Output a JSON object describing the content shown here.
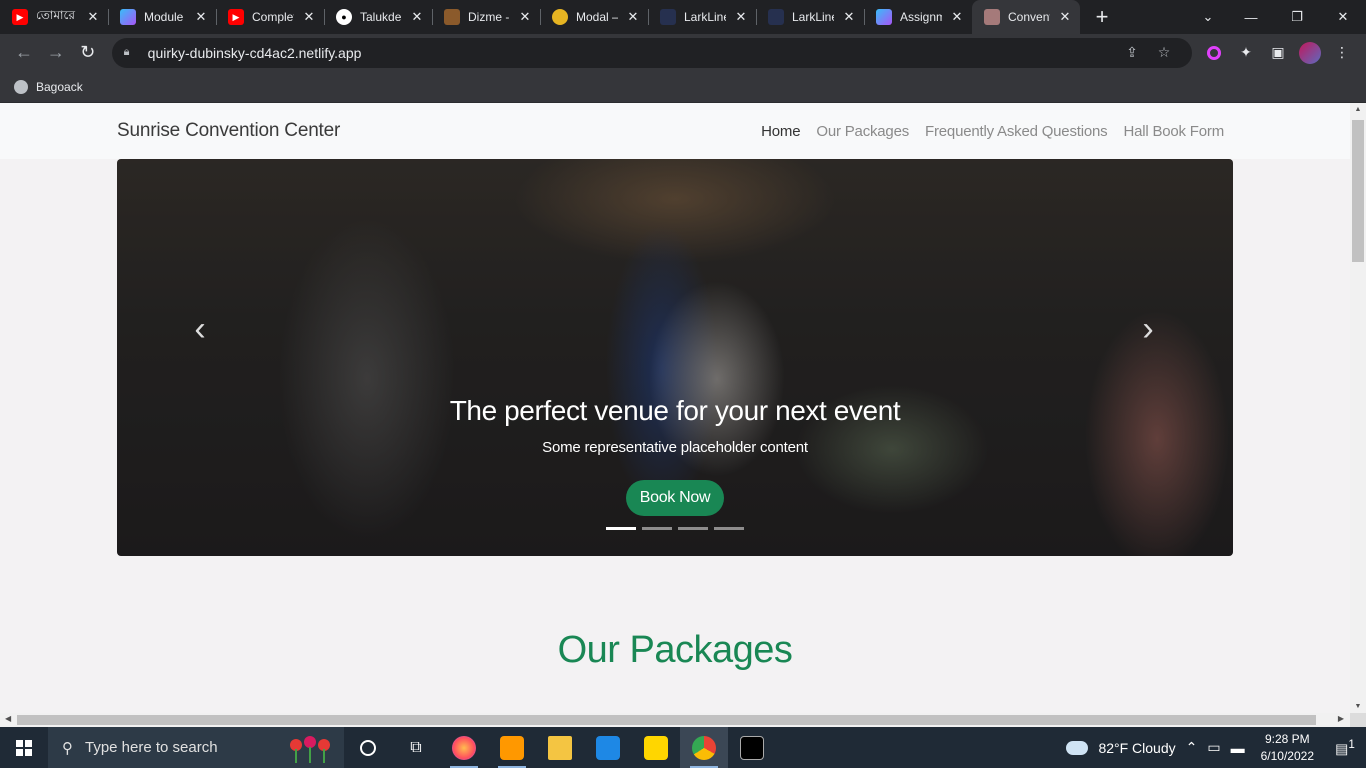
{
  "browser": {
    "tabs": [
      {
        "title": "তোমারে",
        "favicon": "youtube-icon",
        "color": "#ff0000"
      },
      {
        "title": "Module",
        "favicon": "module-icon",
        "color": "#7b61ff"
      },
      {
        "title": "Complet",
        "favicon": "youtube-icon",
        "color": "#ff0000"
      },
      {
        "title": "Talukder",
        "favicon": "github-icon",
        "color": "#ffffff"
      },
      {
        "title": "Dizme -",
        "favicon": "dizme-icon",
        "color": "#8b5a2b"
      },
      {
        "title": "Modal –",
        "favicon": "flower-icon",
        "color": "#e6b422"
      },
      {
        "title": "LarkLine",
        "favicon": "larkline-icon",
        "color": "#3c4a7a"
      },
      {
        "title": "LarkLine",
        "favicon": "larkline-icon",
        "color": "#3c4a7a"
      },
      {
        "title": "Assignm",
        "favicon": "module-icon",
        "color": "#7b61ff"
      },
      {
        "title": "Convent",
        "favicon": "image-icon",
        "color": "#a57a7a",
        "active": true
      }
    ],
    "new_tab": "+",
    "address": "quirky-dubinsky-cd4ac2.netlify.app",
    "bookmark": "Bagoack"
  },
  "page": {
    "brand": "Sunrise Convention Center",
    "nav": [
      "Home",
      "Our Packages",
      "Frequently Asked Questions",
      "Hall Book Form"
    ],
    "carousel": {
      "heading": "The perfect venue for your next event",
      "subtext": "Some representative placeholder content",
      "button": "Book Now",
      "prev": "‹",
      "next": "›",
      "slides": 4,
      "active_slide": 1
    },
    "section_title": "Our Packages",
    "accent": "#198754"
  },
  "taskbar": {
    "search_placeholder": "Type here to search",
    "weather": "82°F  Cloudy",
    "time": "9:28 PM",
    "date": "6/10/2022",
    "notifications": "1"
  }
}
